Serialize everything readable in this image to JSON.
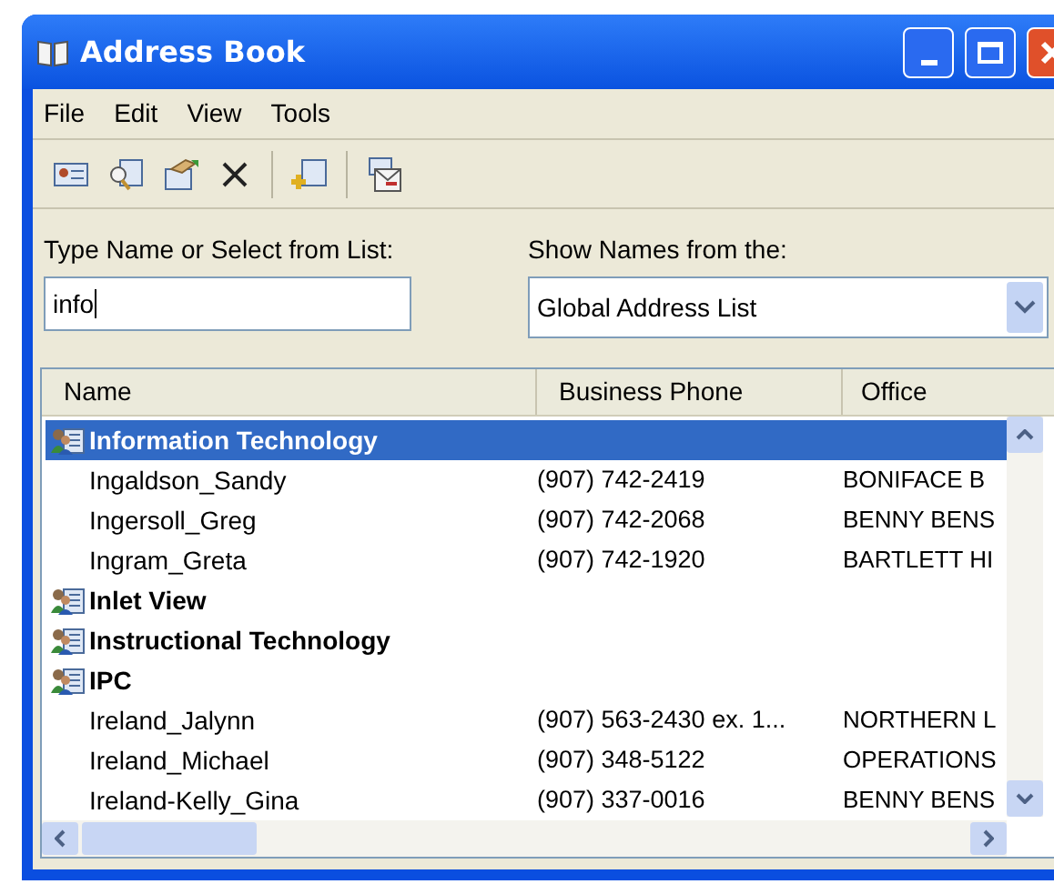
{
  "window": {
    "title": "Address Book"
  },
  "menu": [
    "File",
    "Edit",
    "View",
    "Tools"
  ],
  "search": {
    "label": "Type Name or Select from List:",
    "value": "info"
  },
  "source": {
    "label": "Show Names from the:",
    "value": "Global Address List"
  },
  "table": {
    "columns": [
      "Name",
      "Business Phone",
      "Office"
    ],
    "rows": [
      {
        "kind": "group",
        "name": "Information Technology",
        "selected": true
      },
      {
        "kind": "person",
        "name": "Ingaldson_Sandy",
        "phone": "(907) 742-2419",
        "office": "BONIFACE B",
        "selected": false
      },
      {
        "kind": "person",
        "name": "Ingersoll_Greg",
        "phone": "(907) 742-2068",
        "office": "BENNY BENS",
        "selected": false
      },
      {
        "kind": "person",
        "name": "Ingram_Greta",
        "phone": "(907) 742-1920",
        "office": "BARTLETT HI",
        "selected": false
      },
      {
        "kind": "group",
        "name": "Inlet View",
        "selected": false
      },
      {
        "kind": "group",
        "name": "Instructional Technology",
        "selected": false
      },
      {
        "kind": "group",
        "name": "IPC",
        "selected": false
      },
      {
        "kind": "person",
        "name": "Ireland_Jalynn",
        "phone": "(907) 563-2430 ex. 1...",
        "office": "NORTHERN L",
        "selected": false
      },
      {
        "kind": "person",
        "name": "Ireland_Michael",
        "phone": "(907) 348-5122",
        "office": "OPERATIONS",
        "selected": false
      },
      {
        "kind": "person",
        "name": "Ireland-Kelly_Gina",
        "phone": "(907) 337-0016",
        "office": "BENNY BENS",
        "selected": false
      }
    ]
  }
}
